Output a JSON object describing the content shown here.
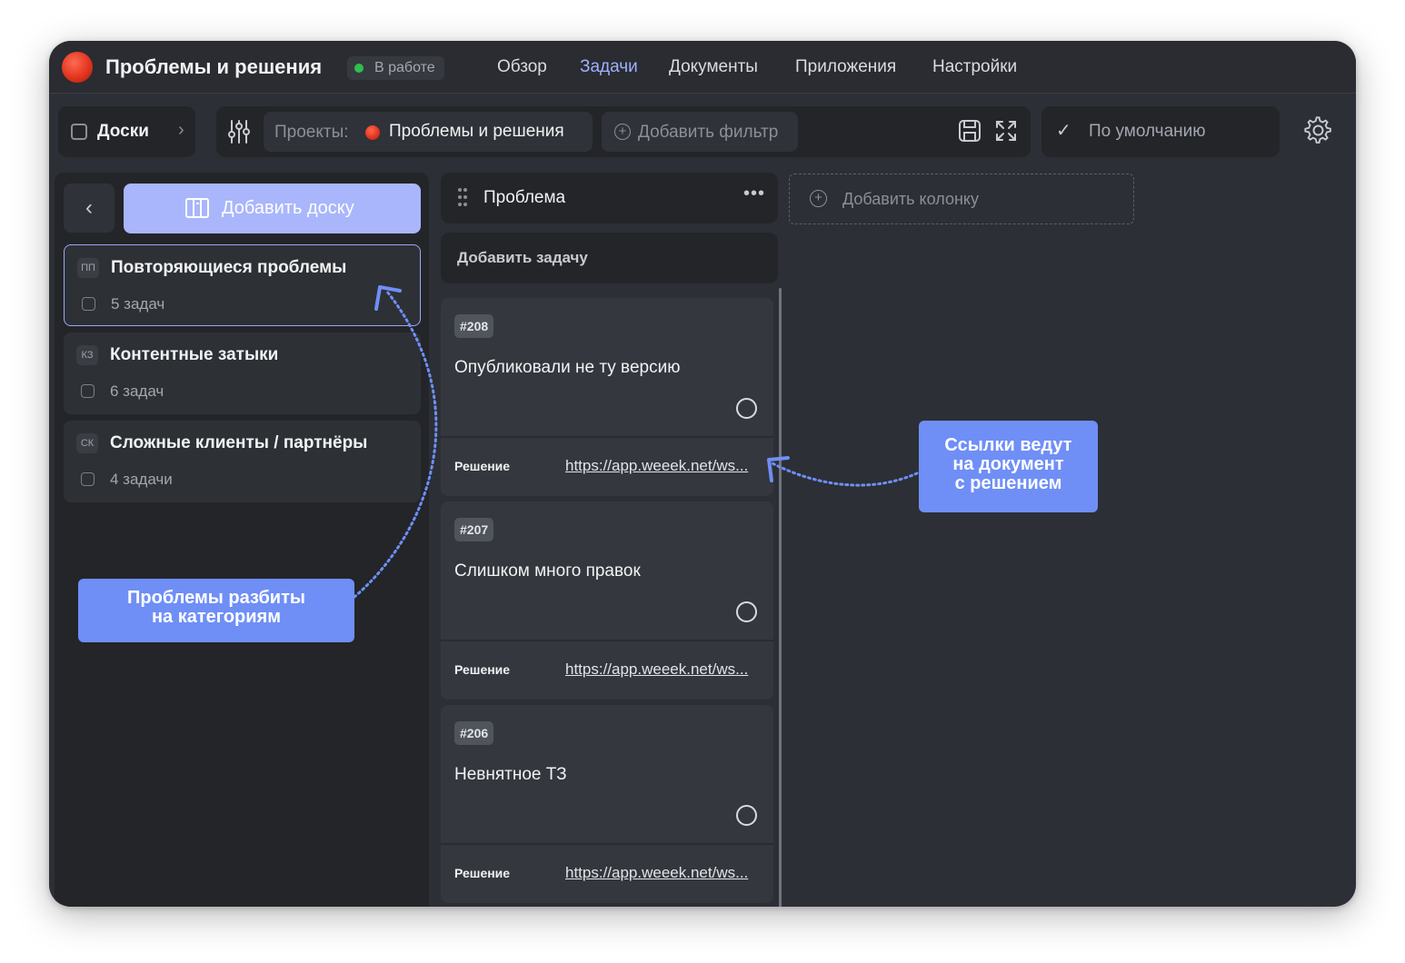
{
  "app": {
    "project_title": "Проблемы и решения",
    "status": "В работе",
    "status_color": "#2fbf4a",
    "accent_color": "#9fb0ff"
  },
  "nav": {
    "items": [
      "Обзор",
      "Задачи",
      "Документы",
      "Приложения",
      "Настройки"
    ],
    "active": "Задачи"
  },
  "toolbar": {
    "boards_label": "Доски",
    "projects_key": "Проекты:",
    "projects_value": "Проблемы и решения",
    "add_filter_label": "Добавить фильтр",
    "default_view_label": "По умолчанию"
  },
  "sidebar": {
    "add_board_label": "Добавить доску",
    "boards": [
      {
        "abbr": "ПП",
        "name": "Повторяющиеся проблемы",
        "count": "5 задач",
        "selected": true
      },
      {
        "abbr": "КЗ",
        "name": "Контентные затыки",
        "count": "6 задач",
        "selected": false
      },
      {
        "abbr": "СК",
        "name": "Сложные клиенты / партнёры",
        "count": "4 задачи",
        "selected": false
      }
    ]
  },
  "column": {
    "name": "Проблема",
    "add_task_label": "Добавить задачу",
    "add_column_label": "Добавить колонку",
    "cards": [
      {
        "id": "#208",
        "title": "Опубликовали не ту версию",
        "field_label": "Решение",
        "link": "https://app.weeek.net/ws..."
      },
      {
        "id": "#207",
        "title": "Слишком много правок",
        "field_label": "Решение",
        "link": "https://app.weeek.net/ws..."
      },
      {
        "id": "#206",
        "title": "Невнятное ТЗ",
        "field_label": "Решение",
        "link": "https://app.weeek.net/ws..."
      }
    ]
  },
  "annotations": {
    "categories_note": [
      "Проблемы разбиты",
      "на категориям"
    ],
    "links_note": [
      "Ссылки ведут",
      "на документ",
      "с решением"
    ],
    "color": "#6f8ff6"
  }
}
